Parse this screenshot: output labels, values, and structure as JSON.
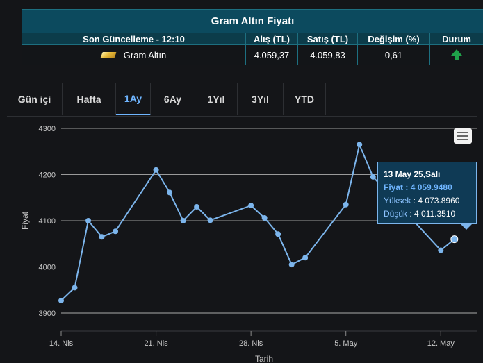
{
  "table": {
    "title": "Gram Altın Fiyatı",
    "headers": {
      "updated": "Son Güncelleme - 12:10",
      "buy": "Alış (TL)",
      "sell": "Satış (TL)",
      "change": "Değişim (%)",
      "status": "Durum"
    },
    "row": {
      "name": "Gram Altın",
      "buy": "4.059,37",
      "sell": "4.059,83",
      "change": "0,61",
      "status_icon": "arrow-up-icon",
      "status_color": "#1fa34a"
    }
  },
  "tabs": [
    {
      "label": "Gün içi",
      "active": false
    },
    {
      "label": "Hafta",
      "active": false
    },
    {
      "label": "1Ay",
      "active": true
    },
    {
      "label": "6Ay",
      "active": false
    },
    {
      "label": "1Yıl",
      "active": false
    },
    {
      "label": "3Yıl",
      "active": false
    },
    {
      "label": "YTD",
      "active": false
    }
  ],
  "chart_menu_icon": "hamburger-menu-icon",
  "tooltip": {
    "date": "13 May 25,Salı",
    "price_label": "Fiyat",
    "price": "4 059.9480",
    "high_label": "Yüksek",
    "high": "4 073.8960",
    "low_label": "Düşük",
    "low": "4 011.3510"
  },
  "chart_data": {
    "type": "line",
    "xlabel": "Tarih",
    "ylabel": "Fiyat",
    "ylim": [
      3900,
      4300
    ],
    "yticks": [
      3900,
      4000,
      4100,
      4200,
      4300
    ],
    "xlim": [
      "2025-04-14",
      "2025-05-14"
    ],
    "xticks": [
      {
        "date": "2025-04-14",
        "label": "14. Nis"
      },
      {
        "date": "2025-04-21",
        "label": "21. Nis"
      },
      {
        "date": "2025-04-28",
        "label": "28. Nis"
      },
      {
        "date": "2025-05-05",
        "label": "5. May"
      },
      {
        "date": "2025-05-12",
        "label": "12. May"
      }
    ],
    "grid": true,
    "line_color": "#7cb5ec",
    "series": [
      {
        "points": [
          {
            "x": "2025-04-14",
            "y": 3927
          },
          {
            "x": "2025-04-15",
            "y": 3955
          },
          {
            "x": "2025-04-16",
            "y": 4100
          },
          {
            "x": "2025-04-17",
            "y": 4065
          },
          {
            "x": "2025-04-18",
            "y": 4077
          },
          {
            "x": "2025-04-21",
            "y": 4210
          },
          {
            "x": "2025-04-22",
            "y": 4161
          },
          {
            "x": "2025-04-23",
            "y": 4100
          },
          {
            "x": "2025-04-24",
            "y": 4130
          },
          {
            "x": "2025-04-25",
            "y": 4101
          },
          {
            "x": "2025-04-28",
            "y": 4133
          },
          {
            "x": "2025-04-29",
            "y": 4106
          },
          {
            "x": "2025-04-30",
            "y": 4071
          },
          {
            "x": "2025-05-01",
            "y": 4005
          },
          {
            "x": "2025-05-02",
            "y": 4020
          },
          {
            "x": "2025-05-05",
            "y": 4135
          },
          {
            "x": "2025-05-06",
            "y": 4265
          },
          {
            "x": "2025-05-07",
            "y": 4195
          },
          {
            "x": "2025-05-12",
            "y": 4036
          },
          {
            "x": "2025-05-13",
            "y": 4060
          }
        ]
      }
    ]
  }
}
